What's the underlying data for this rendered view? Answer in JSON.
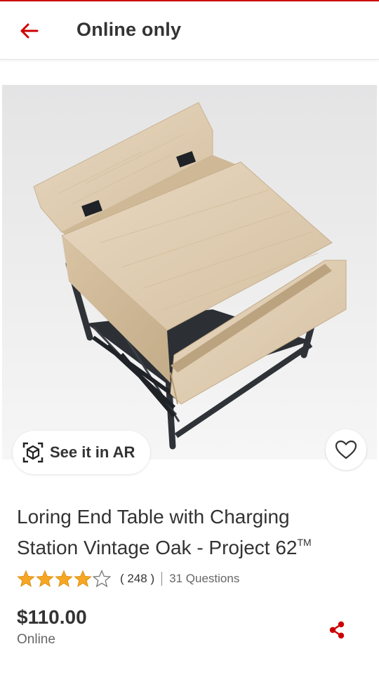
{
  "header": {
    "title": "Online only",
    "accent_color": "#cc0000"
  },
  "gallery": {
    "image_alt": "Loring End Table with Charging Station Vintage Oak",
    "ar_label": "See it in AR"
  },
  "product": {
    "title": "Loring End Table with Charging Station Vintage Oak - Project 62",
    "trademark": "TM",
    "rating": 4.2,
    "rating_max": 5,
    "review_count": "( 248 )",
    "questions": "31 Questions",
    "price": "$110.00",
    "availability": "Online"
  },
  "icons": {
    "back": "arrow-left-icon",
    "ar": "ar-cube-icon",
    "favorite": "heart-outline-icon",
    "share": "share-icon",
    "star_color": "#f5a623"
  }
}
